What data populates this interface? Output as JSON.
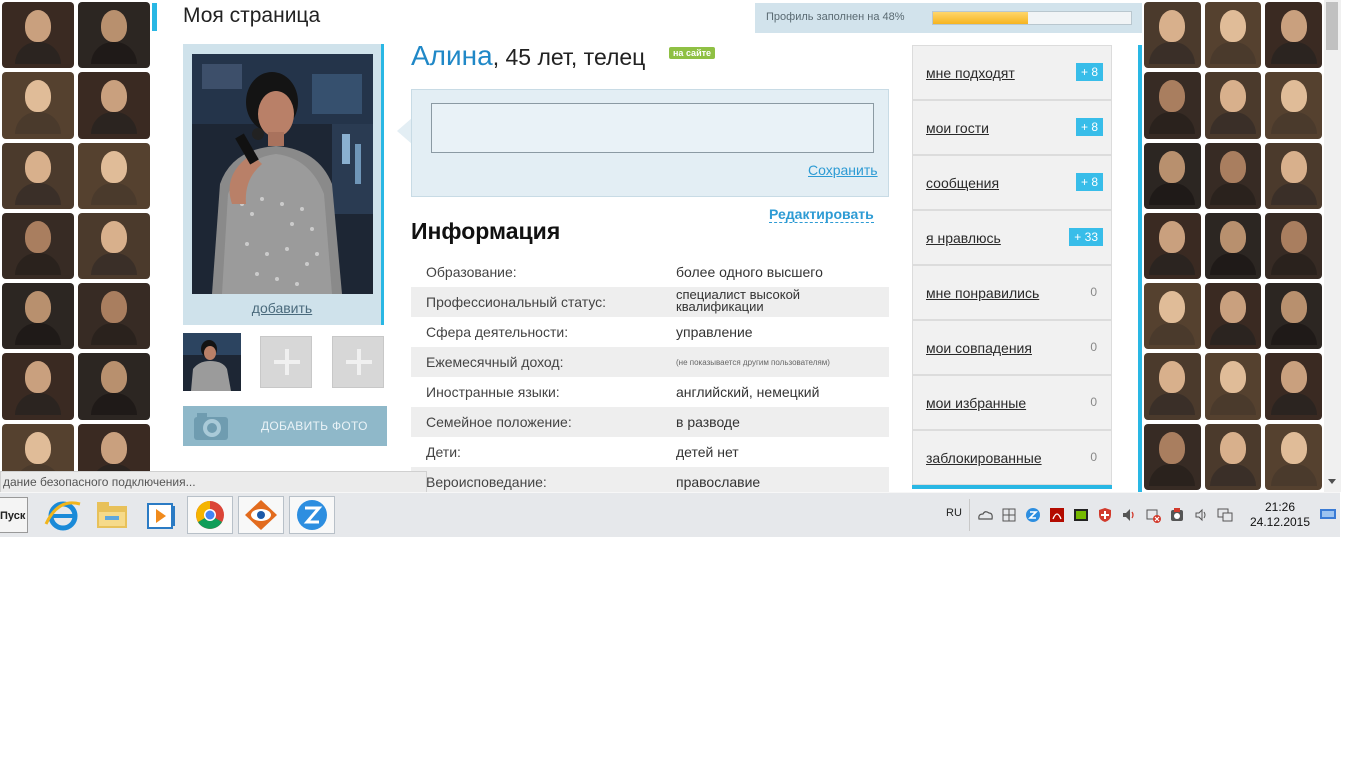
{
  "page": {
    "title": "Моя страница",
    "profile_progress_label": "Профиль заполнен на 48%",
    "profile_progress": 0.48
  },
  "photo": {
    "add_link": "добавить",
    "add_photo_button": "ДОБАВИТЬ ФОТО"
  },
  "profile": {
    "name": "Алина",
    "details": ", 45 лет, телец",
    "online_badge": "на сайте",
    "status_placeholder": "",
    "save_link": "Сохранить",
    "edit_link": "Редактировать",
    "info_title": "Информация",
    "info": [
      {
        "key": "Образование:",
        "value": "более одного высшего"
      },
      {
        "key": "Профессиональный статус:",
        "value": "специалист высокой квалификации"
      },
      {
        "key": "Сфера деятельности:",
        "value": "управление"
      },
      {
        "key": "Ежемесячный доход:",
        "value": "(не показывается другим пользователям)"
      },
      {
        "key": "Иностранные языки:",
        "value": "английский, немецкий"
      },
      {
        "key": "Семейное положение:",
        "value": "в разводе"
      },
      {
        "key": "Дети:",
        "value": "детей нет"
      },
      {
        "key": "Вероисповедание:",
        "value": "православие"
      }
    ]
  },
  "menu": {
    "items": [
      {
        "label": "мне подходят",
        "badge": "+ 8"
      },
      {
        "label": "мои гости",
        "badge": "+ 8"
      },
      {
        "label": "сообщения",
        "badge": "+ 8"
      },
      {
        "label": "я нравлюсь",
        "badge": "+ 33"
      },
      {
        "label": "мне понравились",
        "count": "0"
      },
      {
        "label": "мои совпадения",
        "count": "0"
      },
      {
        "label": "мои избранные",
        "count": "0"
      },
      {
        "label": "заблокированные",
        "count": "0"
      }
    ]
  },
  "browser": {
    "status_text": "дание безопасного подключения..."
  },
  "taskbar": {
    "start_label": "Пуск",
    "apps": [
      "internet-explorer-icon",
      "file-explorer-icon",
      "media-player-icon",
      "chrome-icon",
      "faststone-icon",
      "zona-icon"
    ],
    "language": "RU",
    "time": "21:26",
    "date": "24.12.2015"
  },
  "colors": {
    "accent": "#29b7e4",
    "link": "#2d9bd4",
    "name": "#2088c7",
    "online": "#8fc044",
    "badge": "#38bde9"
  }
}
